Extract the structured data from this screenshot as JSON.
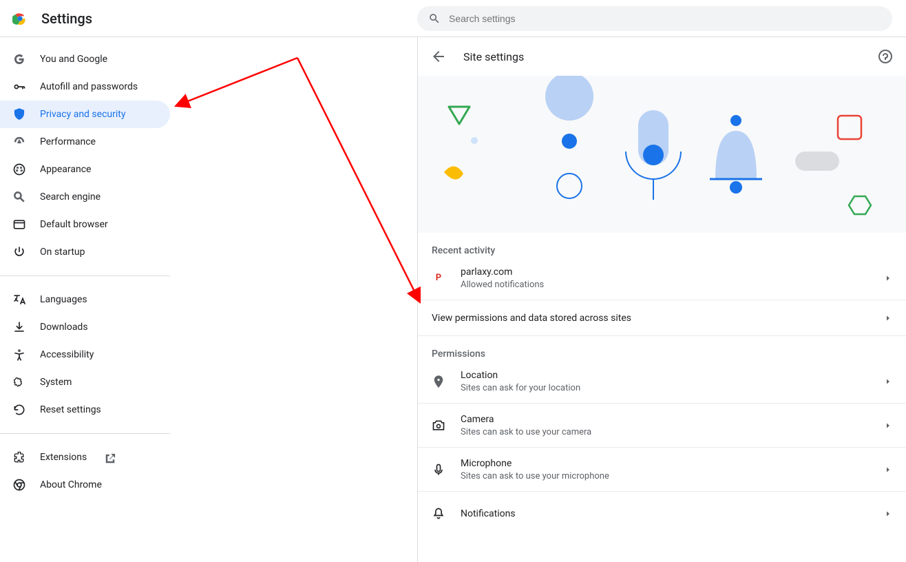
{
  "header": {
    "app_title": "Settings",
    "search_placeholder": "Search settings"
  },
  "sidebar": {
    "sections": [
      {
        "items": [
          {
            "id": "you-and-google",
            "label": "You and Google",
            "icon": "google"
          },
          {
            "id": "autofill",
            "label": "Autofill and passwords",
            "icon": "key"
          },
          {
            "id": "privacy",
            "label": "Privacy and security",
            "icon": "shield",
            "selected": true
          },
          {
            "id": "performance",
            "label": "Performance",
            "icon": "speed"
          },
          {
            "id": "appearance",
            "label": "Appearance",
            "icon": "palette"
          },
          {
            "id": "search-engine",
            "label": "Search engine",
            "icon": "search"
          },
          {
            "id": "default-browser",
            "label": "Default browser",
            "icon": "browser"
          },
          {
            "id": "on-startup",
            "label": "On startup",
            "icon": "power"
          }
        ]
      },
      {
        "items": [
          {
            "id": "languages",
            "label": "Languages",
            "icon": "lang"
          },
          {
            "id": "downloads",
            "label": "Downloads",
            "icon": "download"
          },
          {
            "id": "accessibility",
            "label": "Accessibility",
            "icon": "a11y"
          },
          {
            "id": "system",
            "label": "System",
            "icon": "system"
          },
          {
            "id": "reset",
            "label": "Reset settings",
            "icon": "reset"
          }
        ]
      },
      {
        "items": [
          {
            "id": "extensions",
            "label": "Extensions",
            "icon": "ext",
            "external": true
          },
          {
            "id": "about",
            "label": "About Chrome",
            "icon": "chrome"
          }
        ]
      }
    ]
  },
  "main": {
    "title": "Site settings",
    "recent_label": "Recent activity",
    "recent": {
      "site": "parlaxy.com",
      "detail": "Allowed notifications"
    },
    "view_all": "View permissions and data stored across sites",
    "permissions_label": "Permissions",
    "permissions": [
      {
        "id": "location",
        "title": "Location",
        "sub": "Sites can ask for your location",
        "icon": "location"
      },
      {
        "id": "camera",
        "title": "Camera",
        "sub": "Sites can ask to use your camera",
        "icon": "camera"
      },
      {
        "id": "microphone",
        "title": "Microphone",
        "sub": "Sites can ask to use your microphone",
        "icon": "mic"
      },
      {
        "id": "notifications",
        "title": "Notifications",
        "sub": "",
        "icon": "bell"
      }
    ]
  }
}
